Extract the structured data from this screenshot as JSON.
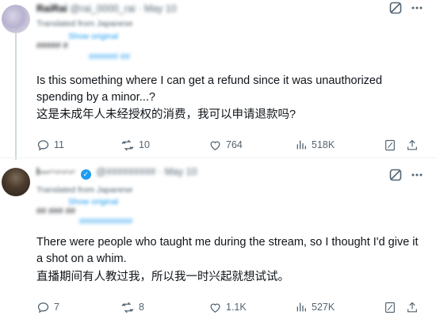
{
  "posts": [
    {
      "header": {
        "display_name": "RaiRai",
        "handle": "@rai_0000_rai",
        "date": "· May 10"
      },
      "translated": {
        "label": "Translated from Japanese",
        "show_original": "Show original"
      },
      "blurred_line": "##### #",
      "blurred_link": "###### ##",
      "text_en": "Is this something where I can get a refund since it was unauthorized spending by a minor...?",
      "text_cn": "这是未成年人未经授权的消费，我可以申请退款吗?",
      "actions": {
        "replies": "11",
        "reposts": "10",
        "likes": "764",
        "views": "518K"
      }
    },
    {
      "header": {
        "display_name": "I---··-·-·-·",
        "handle": "@#########  · May 10",
        "date": ""
      },
      "translated": {
        "label": "Translated from Japanese",
        "show_original": "Show original"
      },
      "blurred_line": "## ### ##",
      "blurred_link": "###########",
      "text_en": "There were people who taught me during the stream, so I thought I'd give it a shot on a whim.",
      "text_cn": "直播期间有人教过我，所以我一时兴起就想试试。",
      "actions": {
        "replies": "7",
        "reposts": "8",
        "likes": "1.1K",
        "views": "527K"
      }
    }
  ],
  "icons": {
    "grok": "grok-icon",
    "more": "more-icon",
    "reply": "reply-icon",
    "repost": "repost-icon",
    "like": "heart-icon",
    "views": "views-icon",
    "bookmark": "bookmark-icon",
    "share": "share-icon"
  },
  "colors": {
    "text": "#0f1419",
    "muted": "#536471",
    "accent": "#1d9bf0",
    "divider": "#eff3f4"
  }
}
